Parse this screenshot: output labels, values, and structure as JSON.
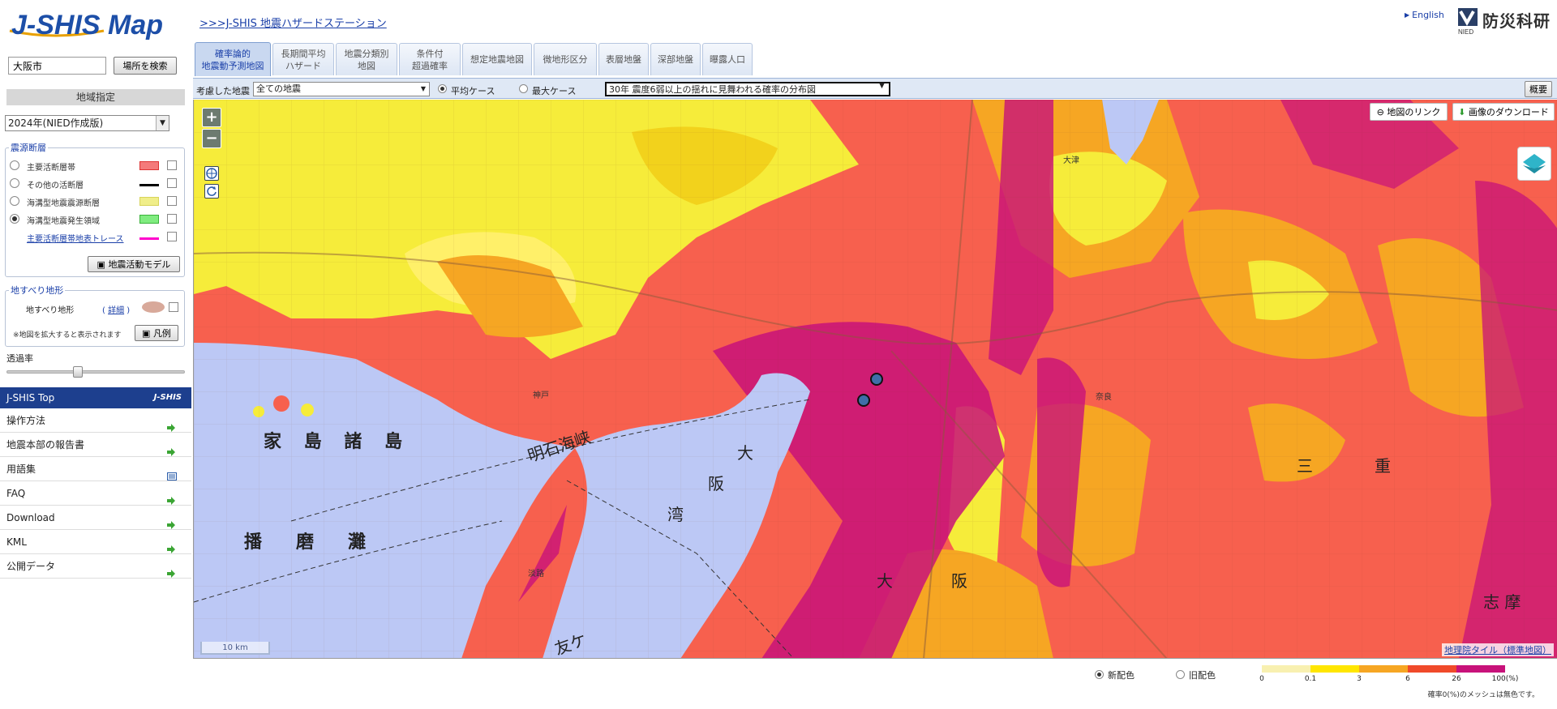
{
  "header": {
    "logo_text": "J-SHIS Map",
    "station_link": ">>>J-SHIS 地震ハザードステーション",
    "english": "English",
    "org_name": "防災科研",
    "org_abbr": "NIED"
  },
  "search": {
    "value": "大阪市",
    "button": "場所を検索"
  },
  "region": {
    "header": "地域指定",
    "year_option": "2024年(NIED作成版)"
  },
  "faults": {
    "title": "震源断層",
    "items": [
      {
        "label": "主要活断層帯",
        "color": "#f47a7a"
      },
      {
        "label": "その他の活断層",
        "color": "#000000"
      },
      {
        "label": "海溝型地震震源断層",
        "color": "#f0ee8a"
      },
      {
        "label": "海溝型地震発生領域",
        "color": "#80ec80"
      },
      {
        "label": "主要活断層帯地表トレース",
        "color": "#ff00cc"
      }
    ],
    "model_button": "地震活動モデル"
  },
  "landslide": {
    "title": "地すべり地形",
    "label": "地すべり地形",
    "detail": "詳細",
    "note": "※地図を拡大すると表示されます",
    "legend_button": "凡例"
  },
  "opacity": {
    "label": "透過率",
    "value": 0.4
  },
  "nav": {
    "top": "J-SHIS Top",
    "top_logo": "J-SHIS",
    "items": [
      "操作方法",
      "地震本部の報告書",
      "用語集",
      "FAQ",
      "Download",
      "KML",
      "公開データ"
    ]
  },
  "tabs": [
    {
      "line1": "確率論的",
      "line2": "地震動予測地図"
    },
    {
      "line1": "長期間平均",
      "line2": "ハザード"
    },
    {
      "line1": "地震分類別",
      "line2": "地図"
    },
    {
      "line1": "条件付",
      "line2": "超過確率"
    },
    {
      "line1": "想定地震地図",
      "line2": ""
    },
    {
      "line1": "微地形区分",
      "line2": ""
    },
    {
      "line1": "表層地盤",
      "line2": ""
    },
    {
      "line1": "深部地盤",
      "line2": ""
    },
    {
      "line1": "曝露人口",
      "line2": ""
    }
  ],
  "toolbar": {
    "considered_label": "考慮した地震",
    "considered_value": "全ての地震",
    "avg_case": "平均ケース",
    "max_case": "最大ケース",
    "map_type": "30年 震度6弱以上の揺れに見舞われる確率の分布図",
    "overview": "概要"
  },
  "map": {
    "link_button": "地図のリンク",
    "download_button": "画像のダウンロード",
    "zoom_in": "+",
    "zoom_out": "−",
    "scale": "10 km",
    "attribution": "地理院タイル（標準地図）",
    "labels": {
      "ieshima": "家 島 諸 島",
      "harima": "播　磨　灘",
      "akashi": "明石海峡",
      "osaka_bay_1": "大",
      "osaka_bay_2": "阪",
      "osaka_bay_3": "湾",
      "tomogashima": "友ケ",
      "osaka_pref_1": "大",
      "osaka_pref_2": "阪",
      "mie_1": "三",
      "mie_2": "重",
      "shima": "志 摩",
      "otsu": "大津",
      "kobe": "神戸",
      "awaji": "淡路",
      "nara": "奈良"
    }
  },
  "legend": {
    "new_scheme": "新配色",
    "old_scheme": "旧配色",
    "ticks": [
      "0",
      "0.1",
      "3",
      "6",
      "26",
      "100(%)"
    ],
    "colors": [
      "#f8f0b0",
      "#ffe600",
      "#f6a623",
      "#f04a2a",
      "#c8127a"
    ],
    "note": "確率0(%)のメッシュは無色です。"
  }
}
